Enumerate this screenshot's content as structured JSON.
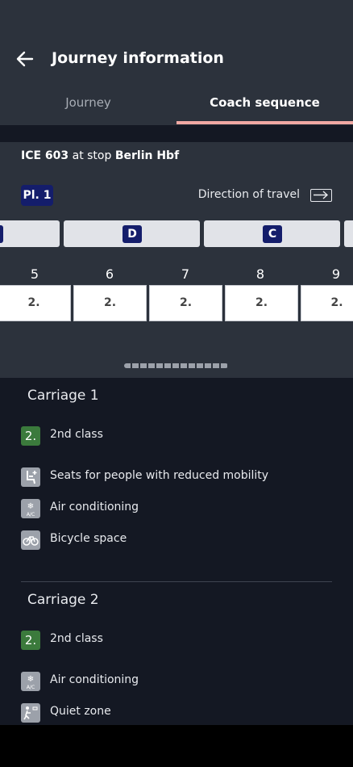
{
  "header": {
    "title": "Journey information"
  },
  "tabs": [
    {
      "label": "Journey"
    },
    {
      "label": "Coach sequence"
    }
  ],
  "train": {
    "name": "ICE 603",
    "at_stop_text": "at stop",
    "station": "Berlin Hbf"
  },
  "platform": {
    "label": "Pl. 1"
  },
  "direction": {
    "label": "Direction of travel"
  },
  "sectors": [
    {
      "label": ""
    },
    {
      "label": "D"
    },
    {
      "label": "C"
    },
    {
      "label": ""
    }
  ],
  "coaches": [
    {
      "number": "5",
      "class": "2."
    },
    {
      "number": "6",
      "class": "2."
    },
    {
      "number": "7",
      "class": "2."
    },
    {
      "number": "8",
      "class": "2."
    },
    {
      "number": "9",
      "class": "2."
    }
  ],
  "carriages": [
    {
      "title": "Carriage 1",
      "class_badge": "2.",
      "class_label": "2nd class",
      "features": [
        {
          "icon": "reduced-mobility-icon",
          "label": "Seats for people with reduced mobility"
        },
        {
          "icon": "air-conditioning-icon",
          "label": "Air conditioning"
        },
        {
          "icon": "bicycle-icon",
          "label": "Bicycle space"
        }
      ]
    },
    {
      "title": "Carriage 2",
      "class_badge": "2.",
      "class_label": "2nd class",
      "features": [
        {
          "icon": "air-conditioning-icon",
          "label": "Air conditioning"
        },
        {
          "icon": "quiet-zone-icon",
          "label": "Quiet zone"
        }
      ]
    }
  ],
  "colors": {
    "accent": "#f0a8a3",
    "sector_badge": "#141d6b",
    "class_badge": "#3b7a3c"
  }
}
